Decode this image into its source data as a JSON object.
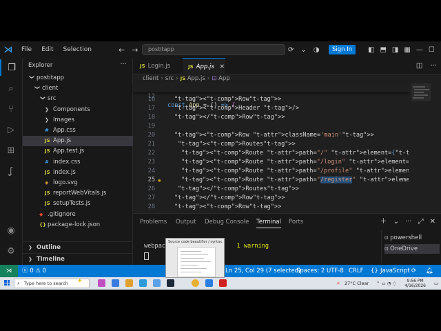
{
  "titlebar": {
    "menu": [
      "File",
      "Edit",
      "Selection"
    ],
    "search_text": "postitapp",
    "signin_label": "Sign In"
  },
  "sidebar": {
    "title": "Explorer",
    "tree": [
      {
        "label": "postitapp",
        "indent": 0,
        "type": "folder-open"
      },
      {
        "label": "client",
        "indent": 1,
        "type": "folder-open"
      },
      {
        "label": "src",
        "indent": 2,
        "type": "folder-open"
      },
      {
        "label": "Components",
        "indent": 3,
        "type": "folder-closed"
      },
      {
        "label": "Images",
        "indent": 3,
        "type": "folder-closed"
      },
      {
        "label": "App.css",
        "indent": 3,
        "type": "css"
      },
      {
        "label": "App.js",
        "indent": 3,
        "type": "js",
        "selected": true
      },
      {
        "label": "App.test.js",
        "indent": 3,
        "type": "js"
      },
      {
        "label": "index.css",
        "indent": 3,
        "type": "css"
      },
      {
        "label": "index.js",
        "indent": 3,
        "type": "js"
      },
      {
        "label": "logo.svg",
        "indent": 3,
        "type": "svg"
      },
      {
        "label": "reportWebVitals.js",
        "indent": 3,
        "type": "js"
      },
      {
        "label": "setupTests.js",
        "indent": 3,
        "type": "js"
      },
      {
        "label": ".gitignore",
        "indent": 2,
        "type": "git"
      },
      {
        "label": "package-lock.json",
        "indent": 2,
        "type": "json"
      }
    ],
    "outline_label": "Outline",
    "timeline_label": "Timeline"
  },
  "tabs": [
    {
      "label": "Login.js",
      "active": false
    },
    {
      "label": "App.js",
      "active": true
    }
  ],
  "breadcrumb": [
    "client",
    "src",
    "App.js",
    "App"
  ],
  "editor": {
    "sticky_line": {
      "num": "12",
      "text": "const App = () => {"
    },
    "lines": [
      {
        "num": "16",
        "text": "<Row>"
      },
      {
        "num": "17",
        "text": "<Header />"
      },
      {
        "num": "18",
        "text": "</Row>"
      },
      {
        "num": "19",
        "text": ""
      },
      {
        "num": "20",
        "text": "<Row className='main'>"
      },
      {
        "num": "21",
        "text": "<Routes>"
      },
      {
        "num": "22",
        "text": "<Route path=\"/\" element={<Home />}></Route>"
      },
      {
        "num": "23",
        "text": "<Route path=\"/login\" element={<Login />}></Route>"
      },
      {
        "num": "24",
        "text": "<Route path=\"/profile\" element={<Profile />}></Route>"
      },
      {
        "num": "25",
        "text": "<Route path=\"/register\" element={<Register />}></Route>"
      },
      {
        "num": "26",
        "text": "</Routes>"
      },
      {
        "num": "27",
        "text": "</Row>"
      },
      {
        "num": "28",
        "text": "<Row>"
      }
    ]
  },
  "panel": {
    "tabs": [
      "Problems",
      "Output",
      "Debug Console",
      "Terminal",
      "Ports"
    ],
    "active_tab": "Terminal",
    "terminal_prefix": "webpac",
    "terminal_warning": "1 warning",
    "terminals": [
      "powershell",
      "OneDrive"
    ]
  },
  "statusbar": {
    "problems_errors": "0",
    "problems_warnings": "0",
    "position": "Ln 25, Col 29 (7 selected)",
    "spaces": "Spaces: 2",
    "encoding": "UTF-8",
    "eol": "CRLF",
    "language": "JavaScript"
  },
  "popup": {
    "title": "Source code beautifier / syntax..."
  },
  "taskbar": {
    "search_placeholder": "Type here to search",
    "weather": "27°C Clear",
    "time": "9:56 PM",
    "date": "4/16/2026"
  },
  "colors": {
    "accent": "#0078d4",
    "statusbar": "#0078d4",
    "remote": "#16825d"
  }
}
